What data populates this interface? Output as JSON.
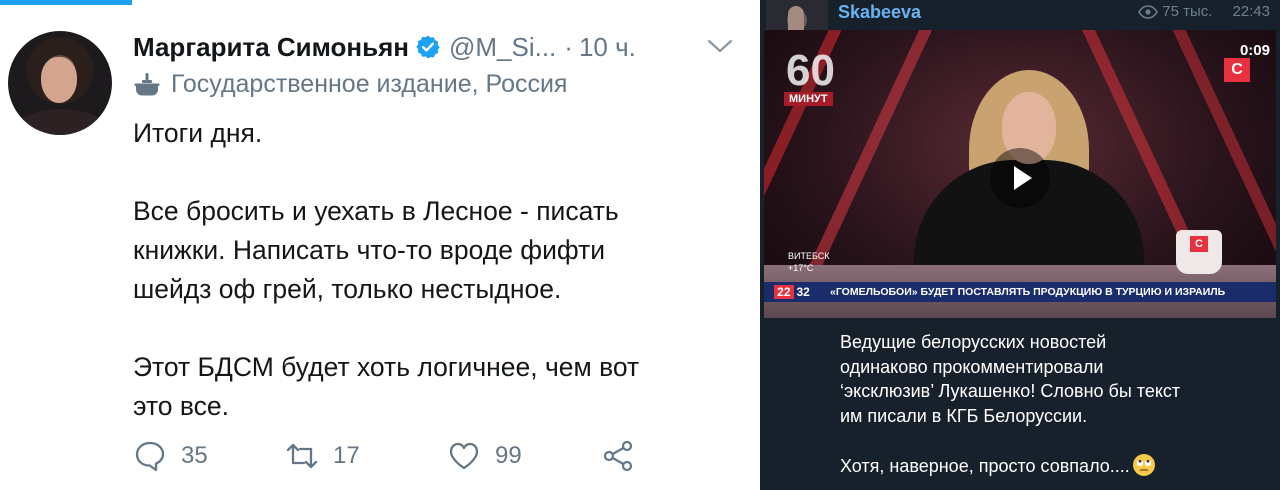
{
  "tweet": {
    "name": "Маргарита Симоньян",
    "handle": "@M_Si...",
    "separator": "·",
    "time": "10 ч.",
    "state_label": "Государственное издание, Россия",
    "body_lines": [
      "Итоги дня.",
      "",
      "Все бросить и уехать в Лесное - писать",
      "книжки. Написать что-то вроде фифти",
      "шейдз оф грей, только нестыдное.",
      "",
      "Этот БДСМ будет хоть логичнее, чем вот",
      "это все."
    ],
    "actions": {
      "replies": "35",
      "retweets": "17",
      "likes": "99"
    },
    "colors": {
      "accent": "#1da1f2",
      "secondary_text": "#657786",
      "primary_text": "#14171a"
    },
    "icons": [
      "verified-badge-icon",
      "government-label-icon",
      "reply-icon",
      "retweet-icon",
      "like-icon",
      "share-icon",
      "chevron-down-icon"
    ]
  },
  "telegram": {
    "channel_name": "Skabeeva",
    "views": "75 тыс.",
    "time": "22:43",
    "video": {
      "duration": "0:09",
      "badge_number": "60",
      "badge_text": "МИНУТ",
      "logo": "С",
      "weather_city": "ВИТЕБСК",
      "weather_temp": "+17°C",
      "clock_hour": "22",
      "clock_minute": "32",
      "ticker_text": "«ГОМЕЛЬОБОИ» БУДЕТ ПОСТАВЛЯТЬ ПРОДУКЦИЮ В ТУРЦИЮ И ИЗРАИЛЬ"
    },
    "caption_lines": [
      "Ведущие белорусских новостей",
      "одинаково прокомментировали",
      "‘эксклюзив’ Лукашенко! Словно бы текст",
      "им писали в КГБ Белоруссии.",
      "",
      "Хотя, наверное, просто совпало...."
    ],
    "colors": {
      "background": "#17212b",
      "channel_name": "#6ab3f3",
      "meta": "#6d7f8f"
    },
    "icons": [
      "eye-icon",
      "play-icon",
      "rolling-eyes-emoji-icon"
    ]
  }
}
